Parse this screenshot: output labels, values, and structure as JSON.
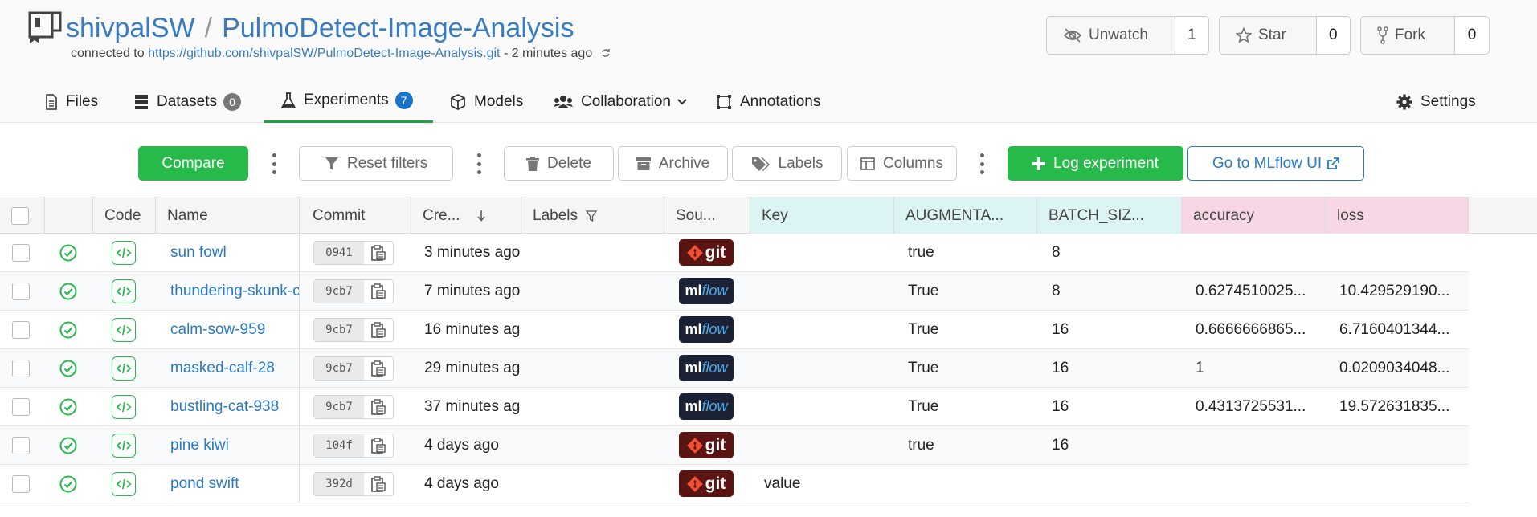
{
  "header": {
    "owner": "shivpalSW",
    "separator": "/",
    "repo": "PulmoDetect-Image-Analysis",
    "connected_prefix": "connected to",
    "connected_url": "https://github.com/shivpalSW/PulmoDetect-Image-Analysis.git",
    "connected_suffix": "- 2 minutes ago",
    "unwatch_label": "Unwatch",
    "unwatch_count": "1",
    "star_label": "Star",
    "star_count": "0",
    "fork_label": "Fork",
    "fork_count": "0"
  },
  "tabs": [
    {
      "label": "Files",
      "icon": "file-icon"
    },
    {
      "label": "Datasets",
      "icon": "database-icon",
      "badge": "0"
    },
    {
      "label": "Experiments",
      "icon": "flask-icon",
      "badge": "7",
      "active": true
    },
    {
      "label": "Models",
      "icon": "cube-icon"
    },
    {
      "label": "Collaboration",
      "icon": "users-icon"
    },
    {
      "label": "Annotations",
      "icon": "crop-icon"
    },
    {
      "label": "Settings",
      "icon": "gear-icon"
    }
  ],
  "toolbar": {
    "compare": "Compare",
    "reset_filters": "Reset filters",
    "delete": "Delete",
    "archive": "Archive",
    "labels": "Labels",
    "columns": "Columns",
    "log_experiment": "Log experiment",
    "mlflow_ui": "Go to MLflow UI"
  },
  "columns": [
    "Code",
    "Name",
    "Commit",
    "Cre...",
    "Labels",
    "Sou...",
    "Key",
    "AUGMENTA...",
    "BATCH_SIZ...",
    "accuracy",
    "loss"
  ],
  "rows": [
    {
      "name": "sun fowl",
      "commit": "0941",
      "created": "3 minutes ago",
      "source": "git",
      "key": "",
      "augmentation": "true",
      "batch_size": "8",
      "accuracy": "",
      "loss": ""
    },
    {
      "name": "thundering-skunk-c",
      "commit": "9cb7",
      "created": "7 minutes ago",
      "source": "mlflow",
      "key": "",
      "augmentation": "True",
      "batch_size": "8",
      "accuracy": "0.6274510025...",
      "loss": "10.429529190..."
    },
    {
      "name": "calm-sow-959",
      "commit": "9cb7",
      "created": "16 minutes ag",
      "source": "mlflow",
      "key": "",
      "augmentation": "True",
      "batch_size": "16",
      "accuracy": "0.6666666865...",
      "loss": "6.7160401344..."
    },
    {
      "name": "masked-calf-28",
      "commit": "9cb7",
      "created": "29 minutes ag",
      "source": "mlflow",
      "key": "",
      "augmentation": "True",
      "batch_size": "16",
      "accuracy": "1",
      "loss": "0.0209034048..."
    },
    {
      "name": "bustling-cat-938",
      "commit": "9cb7",
      "created": "37 minutes ag",
      "source": "mlflow",
      "key": "",
      "augmentation": "True",
      "batch_size": "16",
      "accuracy": "0.4313725531...",
      "loss": "19.572631835..."
    },
    {
      "name": "pine kiwi",
      "commit": "104f",
      "created": "4 days ago",
      "source": "git",
      "key": "",
      "augmentation": "true",
      "batch_size": "16",
      "accuracy": "",
      "loss": ""
    },
    {
      "name": "pond swift",
      "commit": "392d",
      "created": "4 days ago",
      "source": "git",
      "key": "value",
      "augmentation": "",
      "batch_size": "",
      "accuracy": "",
      "loss": ""
    }
  ],
  "source_labels": {
    "git": "git",
    "ml": "ml",
    "flow": "flow"
  },
  "colors": {
    "accent_green": "#27b94a",
    "link_blue": "#2a79c4",
    "git_bg": "#5a1412",
    "mlflow_bg": "#1c2235"
  }
}
